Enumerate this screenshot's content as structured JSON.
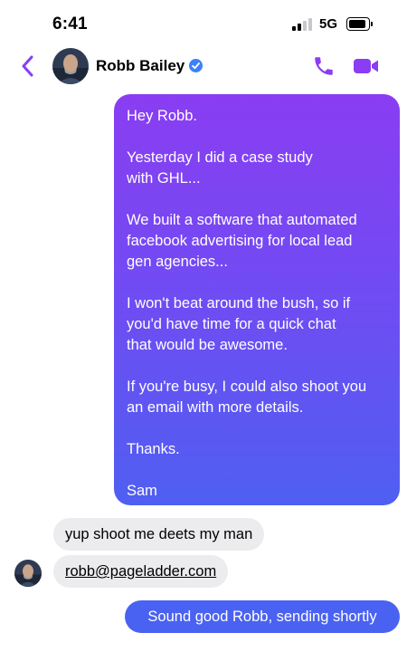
{
  "status_bar": {
    "time": "6:41",
    "network": "5G",
    "icons": [
      "signal-icon",
      "battery-icon"
    ]
  },
  "header": {
    "contact_name": "Robb Bailey",
    "icons": [
      "back-chevron-icon",
      "verified-badge-icon",
      "phone-icon",
      "video-camera-icon"
    ]
  },
  "messages": {
    "outgoing_long": [
      "Hey Robb.",
      "Yesterday I did a case study\nwith GHL...",
      "We built a software that automated\nfacebook advertising for local lead\ngen agencies...",
      "I won't beat around the bush, so if\nyou'd have time for a quick chat\nthat would be awesome.",
      "If you're busy, I could also shoot you\nan email with more details.",
      "Thanks.",
      "Sam"
    ],
    "incoming_1": "yup shoot me deets my man",
    "incoming_2": "robb@pageladder.com",
    "outgoing_short": "Sound good Robb, sending shortly"
  },
  "colors": {
    "accent": "#8a3df2",
    "bubble_gradient_top": "#8a3df2",
    "bubble_gradient_bottom": "#4f5ff2",
    "incoming_bubble": "#ececee",
    "verified_blue": "#3b82f6"
  }
}
